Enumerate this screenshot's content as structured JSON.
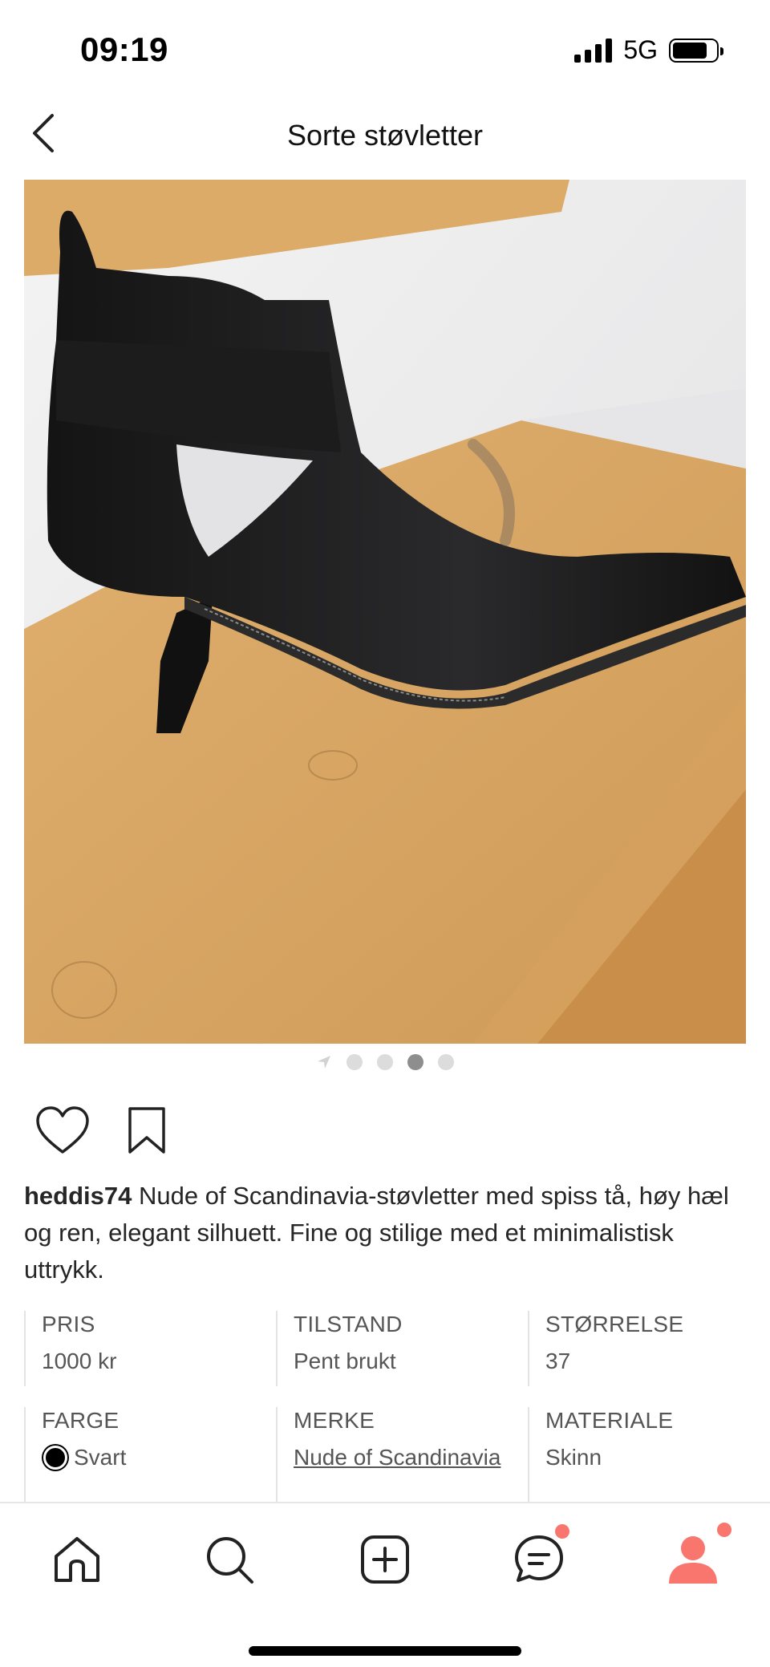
{
  "status_bar": {
    "time": "09:19",
    "network": "5G",
    "battery_level": 0.8
  },
  "header": {
    "title": "Sorte støvletter",
    "back_icon": "chevron-left-icon"
  },
  "photo": {
    "carousel_total": 4,
    "carousel_active": 3
  },
  "actions": {
    "like_icon": "heart-icon",
    "save_icon": "bookmark-icon"
  },
  "description": {
    "username": "heddis74",
    "text": "Nude of Scandinavia-støvletter med spiss tå, høy hæl og ren, elegant silhuett. Fine og stilige med et minimalistisk uttrykk."
  },
  "attributes": {
    "price": {
      "label": "PRIS",
      "value": "1000 kr"
    },
    "condition": {
      "label": "TILSTAND",
      "value": "Pent brukt"
    },
    "size": {
      "label": "STØRRELSE",
      "value": "37"
    },
    "color": {
      "label": "FARGE",
      "value": "Svart",
      "swatch": "#000000"
    },
    "brand": {
      "label": "MERKE",
      "value": "Nude of Scandinavia"
    },
    "material": {
      "label": "MATERIALE",
      "value": "Skinn"
    }
  },
  "bottom_nav": {
    "items": [
      "home-icon",
      "search-icon",
      "add-icon",
      "messages-icon",
      "profile-icon"
    ],
    "accent_color": "#f8766d"
  }
}
